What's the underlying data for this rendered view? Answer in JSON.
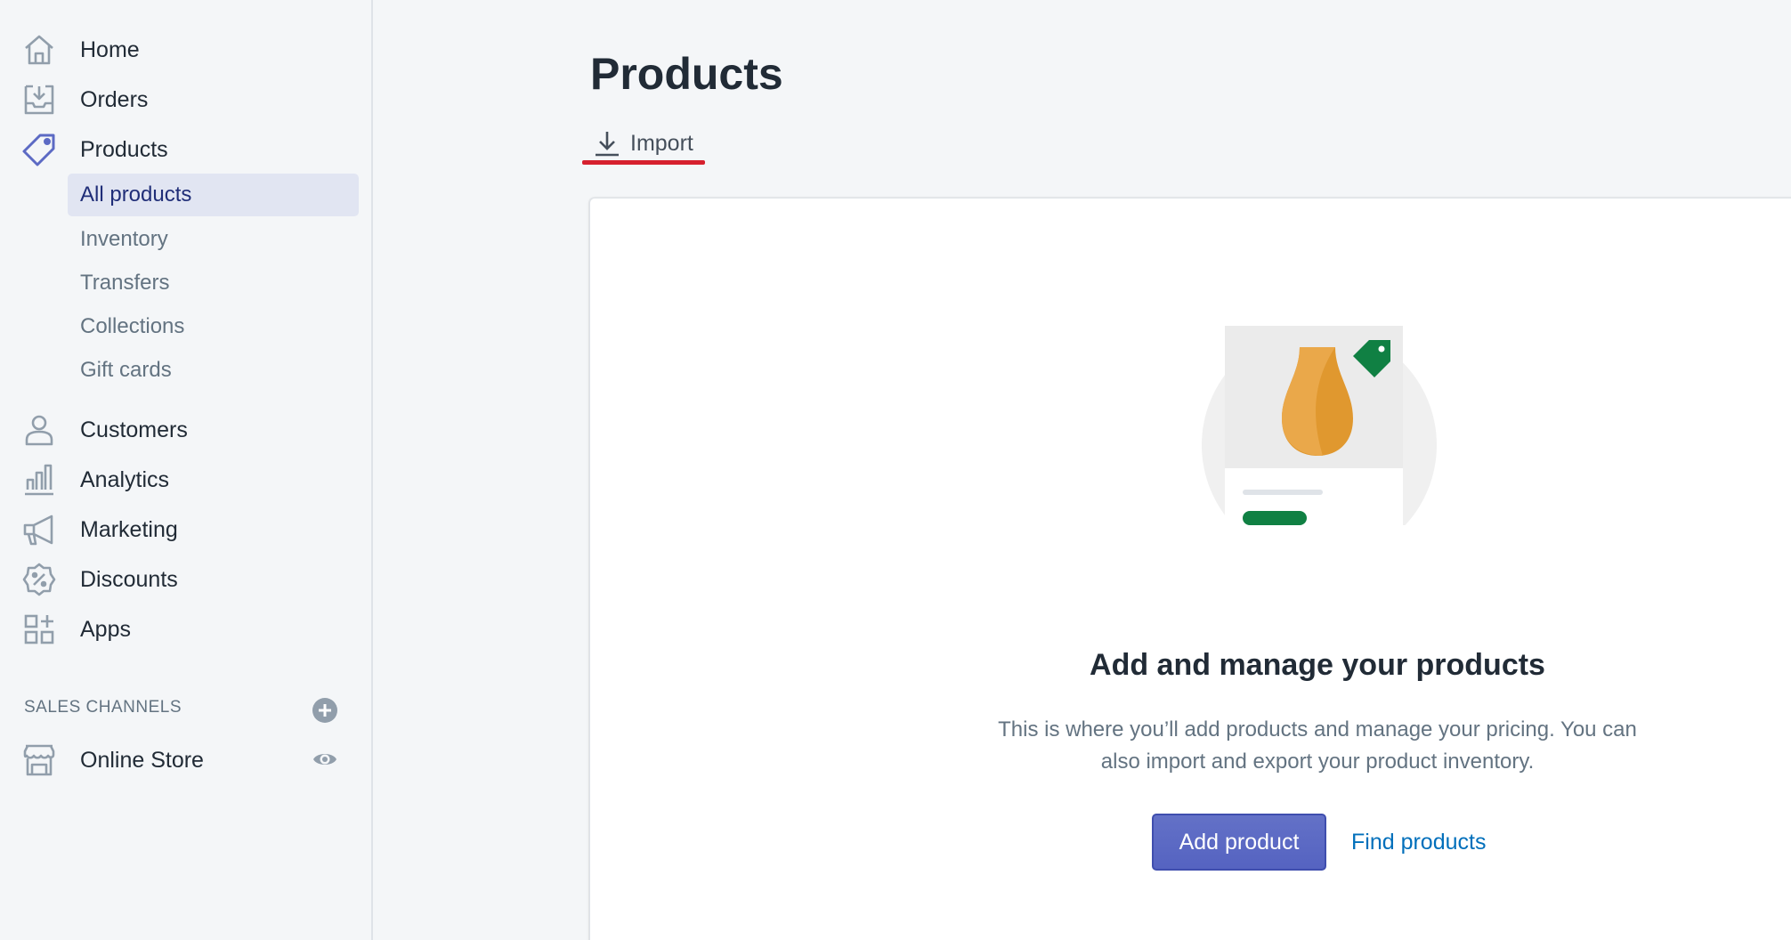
{
  "sidebar": {
    "items": [
      {
        "label": "Home",
        "icon": "home-icon"
      },
      {
        "label": "Orders",
        "icon": "orders-icon"
      },
      {
        "label": "Products",
        "icon": "tag-icon"
      },
      {
        "label": "Customers",
        "icon": "person-icon"
      },
      {
        "label": "Analytics",
        "icon": "bar-chart-icon"
      },
      {
        "label": "Marketing",
        "icon": "megaphone-icon"
      },
      {
        "label": "Discounts",
        "icon": "discount-icon"
      },
      {
        "label": "Apps",
        "icon": "apps-icon"
      }
    ],
    "products_sub": [
      {
        "label": "All products",
        "selected": true
      },
      {
        "label": "Inventory"
      },
      {
        "label": "Transfers"
      },
      {
        "label": "Collections"
      },
      {
        "label": "Gift cards"
      }
    ],
    "sales_channels_title": "SALES CHANNELS",
    "channels": [
      {
        "label": "Online Store",
        "icon": "store-icon"
      }
    ]
  },
  "main": {
    "title": "Products",
    "import_label": "Import",
    "empty_state": {
      "heading": "Add and manage your products",
      "text": "This is where you’ll add products and manage your pricing. You can also import and export your product inventory.",
      "primary_button": "Add product",
      "secondary_link": "Find products"
    }
  },
  "colors": {
    "accent": "#5c6ac4",
    "link": "#006fbb",
    "selected_bg": "#e1e5f2",
    "import_underline": "#d6202e",
    "tag_green": "#108043",
    "vase_orange": "#e0982f"
  }
}
